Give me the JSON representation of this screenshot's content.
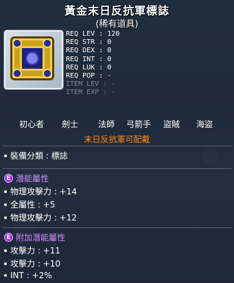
{
  "item": {
    "name": "黃金末日反抗軍標誌",
    "rarity": "(稀有道具)"
  },
  "requirements": [
    {
      "label": "REQ LEV",
      "value": "120",
      "dim": false
    },
    {
      "label": "REQ STR",
      "value": "0",
      "dim": false
    },
    {
      "label": "REQ DEX",
      "value": "0",
      "dim": false
    },
    {
      "label": "REQ INT",
      "value": "0",
      "dim": false
    },
    {
      "label": "REQ LUK",
      "value": "0",
      "dim": false
    },
    {
      "label": "REQ POP",
      "value": "-",
      "dim": false
    },
    {
      "label": "ITEM LEV",
      "value": "-",
      "dim": true
    },
    {
      "label": "ITEM EXP",
      "value": "-",
      "dim": true
    }
  ],
  "jobs": [
    "初心者",
    "劍士",
    "法師",
    "弓箭手",
    "盜賊",
    "海盜"
  ],
  "notice": "末日反抗軍可配戴",
  "equip_type": "裝備分類 : 標誌",
  "potential": {
    "badge": "E",
    "title": "潛能屬性",
    "lines": [
      "物理攻擊力 : +14",
      "全屬性 : +5",
      "物理攻擊力 : +12"
    ]
  },
  "bonus_potential": {
    "badge": "E",
    "title": "附加潛能屬性",
    "lines": [
      "攻擊力 : +11",
      "攻擊力 : +10",
      "INT : +2%"
    ]
  }
}
